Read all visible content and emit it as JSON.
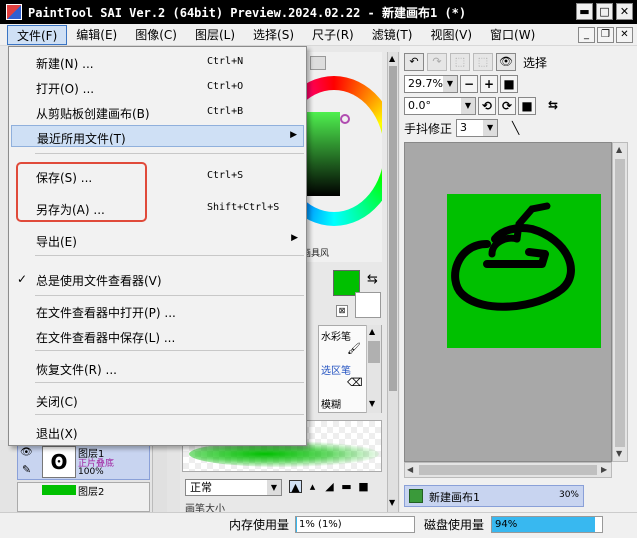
{
  "window": {
    "title": "PaintTool SAI Ver.2 (64bit) Preview.2024.02.22 - 新建画布1 (*)",
    "minimize_symbol": "▬",
    "maximize_symbol": "□",
    "close_symbol": "✕"
  },
  "menubar": {
    "items": [
      "文件(F)",
      "编辑(E)",
      "图像(C)",
      "图层(L)",
      "选择(S)",
      "尺子(R)",
      "滤镜(T)",
      "视图(V)",
      "窗口(W)"
    ],
    "mdi_minimize": "_",
    "mdi_restore": "❐",
    "mdi_close": "✕"
  },
  "file_menu": {
    "new": {
      "label": "新建(N) ...",
      "shortcut": "Ctrl+N"
    },
    "open": {
      "label": "打开(O) ...",
      "shortcut": "Ctrl+O"
    },
    "from_clipboard": {
      "label": "从剪贴板创建画布(B)",
      "shortcut": "Ctrl+B"
    },
    "recent": {
      "label": "最近所用文件(T)",
      "arrow": "▶"
    },
    "save": {
      "label": "保存(S) ...",
      "shortcut": "Ctrl+S"
    },
    "save_as": {
      "label": "另存为(A) ...",
      "shortcut": "Shift+Ctrl+S"
    },
    "export": {
      "label": "导出(E)",
      "arrow": "▶"
    },
    "always_viewer": {
      "label": "总是使用文件查看器(V)",
      "check": "✓"
    },
    "open_in_viewer": {
      "label": "在文件查看器中打开(P) ..."
    },
    "save_in_viewer": {
      "label": "在文件查看器中保存(L) ..."
    },
    "recover": {
      "label": "恢复文件(R) ..."
    },
    "close": {
      "label": "关闭(C)"
    },
    "exit": {
      "label": "退出(X)"
    }
  },
  "right_toolbar": {
    "select_label": "选择",
    "zoom_value": "29.7%",
    "rotation_value": "0.0°",
    "stabilizer_label": "手抖修正",
    "stabilizer_value": "3"
  },
  "tools": {
    "watercolor": "水彩笔",
    "selection": "选区笔",
    "blur": "模糊",
    "brush_fuse": "画具风"
  },
  "brush": {
    "blend_mode": "正常",
    "size_label": "画笔大小"
  },
  "layers": {
    "layer1_name": "图层1",
    "layer1_mode": "正片叠底",
    "layer1_opacity": "100%",
    "layer1_thumb_glyph": "ʘ",
    "layer2_name": "图层2"
  },
  "navigator": {
    "doc_name": "新建画布1",
    "doc_zoom": "30%"
  },
  "statusbar": {
    "memory_label": "内存使用量",
    "memory_value": "1% (1%)",
    "memory_fraction": 0.01,
    "disk_label": "磁盘使用量",
    "disk_value": "94%",
    "disk_fraction": 0.94
  },
  "colors": {
    "foreground": "#00c000",
    "background": "#ffffff",
    "canvas_fill": "#00c000",
    "highlight_box": "#e04a3a"
  }
}
